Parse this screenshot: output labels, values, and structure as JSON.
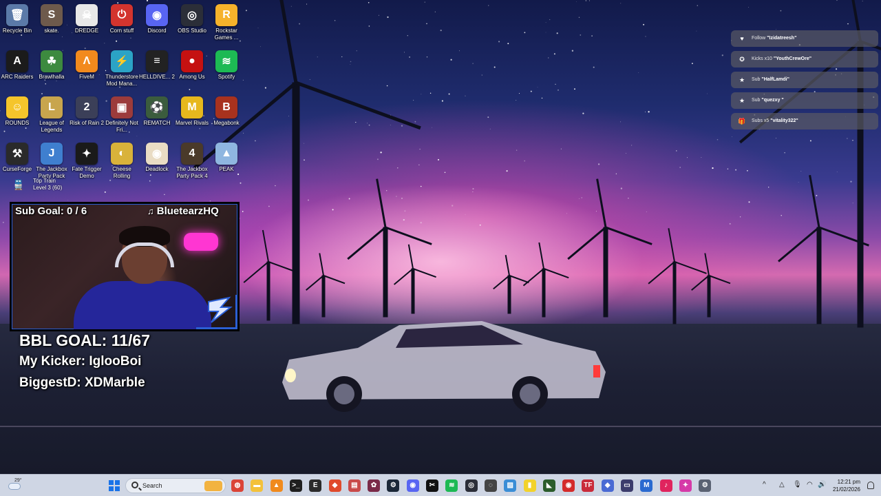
{
  "desktop": {
    "icons": [
      {
        "label": "Recycle Bin",
        "glyph": "🗑",
        "color": "#5b7aa8",
        "icon": "recycle-bin-icon"
      },
      {
        "label": "skate.",
        "glyph": "S",
        "color": "#6e5a4c",
        "icon": "skate-icon"
      },
      {
        "label": "DREDGE",
        "glyph": "☠",
        "color": "#e8e8e8",
        "icon": "dredge-icon"
      },
      {
        "label": "Corn stuff",
        "glyph": "⏻",
        "color": "#d3342e",
        "icon": "corn-stuff-icon"
      },
      {
        "label": "Discord",
        "glyph": "◉",
        "color": "#5865f2",
        "icon": "discord-icon"
      },
      {
        "label": "OBS Studio",
        "glyph": "◎",
        "color": "#2b2e38",
        "icon": "obs-studio-icon"
      },
      {
        "label": "Rockstar Games ...",
        "glyph": "R",
        "color": "#f6b22b",
        "icon": "rockstar-games-icon"
      },
      {
        "label": "ARC Raiders",
        "glyph": "A",
        "color": "#1b1b1b",
        "icon": "arc-raiders-icon"
      },
      {
        "label": "Brawlhalla",
        "glyph": "☘",
        "color": "#3d8a3f",
        "icon": "brawlhalla-icon"
      },
      {
        "label": "FiveM",
        "glyph": "Λ",
        "color": "#f28a1d",
        "icon": "fivem-icon"
      },
      {
        "label": "Thunderstore Mod Mana...",
        "glyph": "⚡",
        "color": "#2ba3c6",
        "icon": "thunderstore-icon"
      },
      {
        "label": "HELLDIVE... 2",
        "glyph": "≡",
        "color": "#222222",
        "icon": "helldivers-icon"
      },
      {
        "label": "Among Us",
        "glyph": "●",
        "color": "#c51111",
        "icon": "among-us-icon"
      },
      {
        "label": "Spotify",
        "glyph": "≋",
        "color": "#1db954",
        "icon": "spotify-icon"
      },
      {
        "label": "ROUNDS",
        "glyph": "☺",
        "color": "#f5c52b",
        "icon": "rounds-icon"
      },
      {
        "label": "League of Legends",
        "glyph": "L",
        "color": "#c8a54d",
        "icon": "league-of-legends-icon"
      },
      {
        "label": "Risk of Rain 2",
        "glyph": "2",
        "color": "#3b3f58",
        "icon": "risk-of-rain-icon"
      },
      {
        "label": "Definitely Not Fri...",
        "glyph": "▣",
        "color": "#9c3b3b",
        "icon": "definitely-not-fried-icon"
      },
      {
        "label": "REMATCH",
        "glyph": "⚽",
        "color": "#3b5c3d",
        "icon": "rematch-icon"
      },
      {
        "label": "Marvel Rivals",
        "glyph": "M",
        "color": "#e7b81d",
        "icon": "marvel-rivals-icon"
      },
      {
        "label": "Megabonk",
        "glyph": "B",
        "color": "#a8321e",
        "icon": "megabonk-icon"
      },
      {
        "label": "CurseForge",
        "glyph": "⚒",
        "color": "#2a2a2a",
        "icon": "curseforge-icon"
      },
      {
        "label": "The Jackbox Party Pack",
        "glyph": "J",
        "color": "#3f7fcf",
        "icon": "jackbox-party-pack-icon"
      },
      {
        "label": "Fate Trigger Demo",
        "glyph": "✦",
        "color": "#1a1a1a",
        "icon": "fate-trigger-icon"
      },
      {
        "label": "Cheese Rolling",
        "glyph": "◐",
        "color": "#d9b23a",
        "icon": "cheese-rolling-icon"
      },
      {
        "label": "Deadlock",
        "glyph": "◉",
        "color": "#e9dcc4",
        "icon": "deadlock-icon"
      },
      {
        "label": "The Jackbox Party Pack 4",
        "glyph": "4",
        "color": "#4a3a2a",
        "icon": "jackbox-party-pack-4-icon"
      },
      {
        "label": "PEAK",
        "glyph": "▲",
        "color": "#8fb6e0",
        "icon": "peak-icon"
      }
    ],
    "top_train": {
      "line1": "Top Train",
      "line2": "Level 3 (60)"
    }
  },
  "overlay": {
    "sub_goal": "Sub Goal: 0 / 6",
    "streamer_name": "BluetearzHQ",
    "note_glyph": "♫",
    "bbl_goal": "BBL GOAL: 11/67",
    "my_kicker": "My Kicker: IglooBoi",
    "biggest_d": "BiggestD: XDMarble"
  },
  "alerts": [
    {
      "icon": "heart-icon",
      "glyph": "♥",
      "prefix": "Follow",
      "name": "\"Izidatreesh\""
    },
    {
      "icon": "kick-icon",
      "glyph": "✪",
      "prefix": "Kicks x10",
      "name": "\"YouthCrewOre\""
    },
    {
      "icon": "star-icon",
      "glyph": "★",
      "prefix": "Sub",
      "name": "\"HalfLamdi\""
    },
    {
      "icon": "star-icon",
      "glyph": "★",
      "prefix": "Sub",
      "name": "\"quezxy \""
    },
    {
      "icon": "gift-icon",
      "glyph": "🎁",
      "prefix": "Subs x5",
      "name": "\"vitality322\""
    }
  ],
  "taskbar": {
    "weather_temp": "29°",
    "search_placeholder": "Search",
    "apps": [
      {
        "icon": "chrome-icon",
        "glyph": "◍",
        "color": "#db4437"
      },
      {
        "icon": "file-explorer-icon",
        "glyph": "▬",
        "color": "#f3c13a"
      },
      {
        "icon": "vlc-icon",
        "glyph": "▲",
        "color": "#f08a1d"
      },
      {
        "icon": "terminal-icon",
        "glyph": ">_",
        "color": "#1f1f1f"
      },
      {
        "icon": "epic-games-icon",
        "glyph": "E",
        "color": "#2b2b2b"
      },
      {
        "icon": "brave-icon",
        "glyph": "◆",
        "color": "#e04a2b"
      },
      {
        "icon": "notes-icon",
        "glyph": "▤",
        "color": "#c94a4a"
      },
      {
        "icon": "game-icon",
        "glyph": "✿",
        "color": "#7a2a48"
      },
      {
        "icon": "steam-icon",
        "glyph": "⚙",
        "color": "#1b2838"
      },
      {
        "icon": "discord-taskbar-icon",
        "glyph": "◉",
        "color": "#5865f2"
      },
      {
        "icon": "capcut-icon",
        "glyph": "✂",
        "color": "#111111"
      },
      {
        "icon": "spotify-taskbar-icon",
        "glyph": "≋",
        "color": "#1db954"
      },
      {
        "icon": "obs-taskbar-icon",
        "glyph": "◎",
        "color": "#2b2e38"
      },
      {
        "icon": "steelseries-icon",
        "glyph": "◌",
        "color": "#444444"
      },
      {
        "icon": "photos-icon",
        "glyph": "▨",
        "color": "#3b8ed6"
      },
      {
        "icon": "sticky-notes-icon",
        "glyph": "▮",
        "color": "#f2d22b"
      },
      {
        "icon": "nvidia-icon",
        "glyph": "◣",
        "color": "#2b5c2b"
      },
      {
        "icon": "rockstar-taskbar-icon",
        "glyph": "◉",
        "color": "#d42b2b"
      },
      {
        "icon": "tf-icon",
        "glyph": "TF",
        "color": "#c92b3a"
      },
      {
        "icon": "app-icon",
        "glyph": "◆",
        "color": "#4a6ad4"
      },
      {
        "icon": "controller-icon",
        "glyph": "▭",
        "color": "#3c3c6c"
      },
      {
        "icon": "mobalytics-icon",
        "glyph": "M",
        "color": "#2a6ad0"
      },
      {
        "icon": "tiktok-icon",
        "glyph": "♪",
        "color": "#e0245e"
      },
      {
        "icon": "gamebar-icon",
        "glyph": "✦",
        "color": "#d63aa8"
      },
      {
        "icon": "settings-icon",
        "glyph": "⚙",
        "color": "#5a6272"
      }
    ],
    "tray": {
      "chevron": "^",
      "time": "12:21 pm",
      "date": "21/02/2026"
    }
  }
}
